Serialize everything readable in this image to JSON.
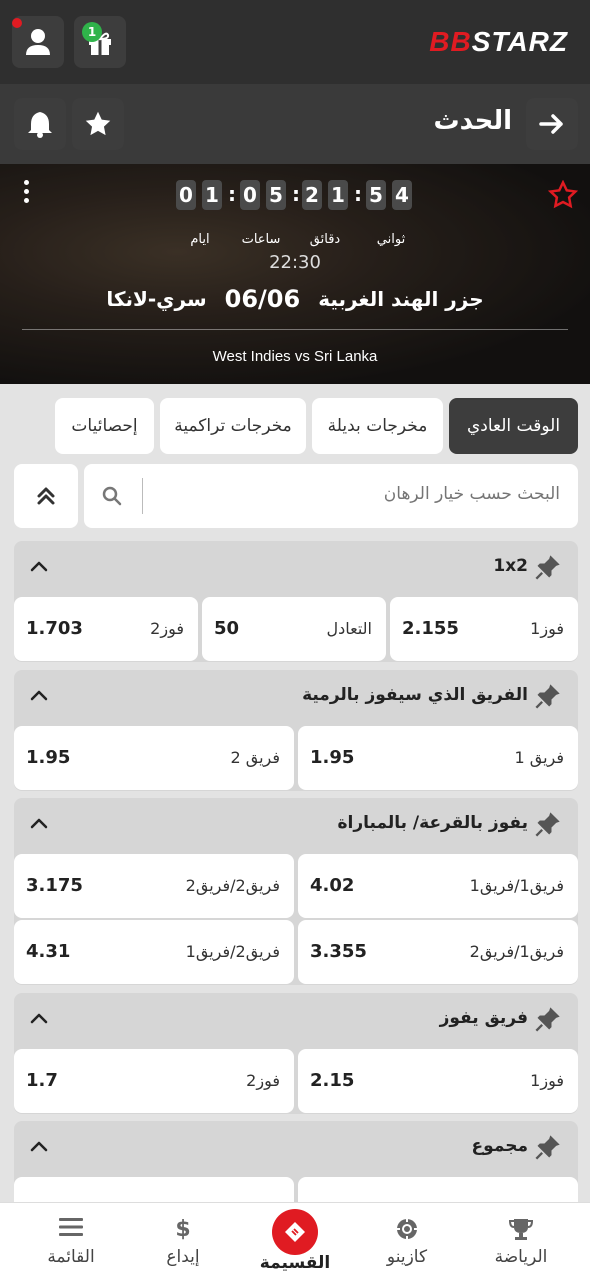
{
  "brand": {
    "logo_prefix": "BB",
    "logo_text": "STARZ",
    "accent": "#e01b22"
  },
  "topbar": {
    "gift_count": "1"
  },
  "header": {
    "title": "الحدث"
  },
  "event": {
    "countdown": {
      "days": [
        "0",
        "1"
      ],
      "hours": [
        "0",
        "5"
      ],
      "minutes": [
        "2",
        "1"
      ],
      "seconds": [
        "5",
        "4"
      ],
      "labels": {
        "days": "ايام",
        "hours": "ساعات",
        "minutes": "دقائق",
        "seconds": "ثواني"
      }
    },
    "time": "22:30",
    "team1": "جزر الهند الغربية",
    "date": "06/06",
    "team2": "سري-لانكا",
    "subtitle": "West Indies vs Sri Lanka"
  },
  "tabs": [
    "الوقت العادي",
    "مخرجات بديلة",
    "مخرجات تراكمية",
    "إحصائيات"
  ],
  "search": {
    "placeholder": "البحث حسب خيار الرهان"
  },
  "markets": [
    {
      "title": "1x2",
      "odds": [
        {
          "label": "فوز1",
          "value": "2.155"
        },
        {
          "label": "التعادل",
          "value": "50"
        },
        {
          "label": "فوز2",
          "value": "1.703"
        }
      ]
    },
    {
      "title": "الفريق الذي سيفوز بالرمية",
      "odds": [
        {
          "label": "فريق 1",
          "value": "1.95"
        },
        {
          "label": "فريق 2",
          "value": "1.95"
        }
      ]
    },
    {
      "title": "يفوز بالقرعة/ بالمباراة",
      "odds": [
        {
          "label": "فريق1/فريق1",
          "value": "4.02"
        },
        {
          "label": "فريق2/فريق2",
          "value": "3.175"
        },
        {
          "label": "فريق1/فريق2",
          "value": "3.355"
        },
        {
          "label": "فريق2/فريق1",
          "value": "4.31"
        }
      ]
    },
    {
      "title": "فريق يفوز",
      "odds": [
        {
          "label": "فوز1",
          "value": "2.15"
        },
        {
          "label": "فوز2",
          "value": "1.7"
        }
      ]
    },
    {
      "title": "مجموع"
    }
  ],
  "bottom_nav": [
    {
      "label": "الرياضة",
      "icon": "trophy-icon"
    },
    {
      "label": "كازينو",
      "icon": "casino-chip-icon"
    },
    {
      "label": "القسيمة",
      "icon": "ticket-icon"
    },
    {
      "label": "إيداع",
      "icon": "dollar-icon"
    },
    {
      "label": "القائمة",
      "icon": "menu-icon"
    }
  ]
}
